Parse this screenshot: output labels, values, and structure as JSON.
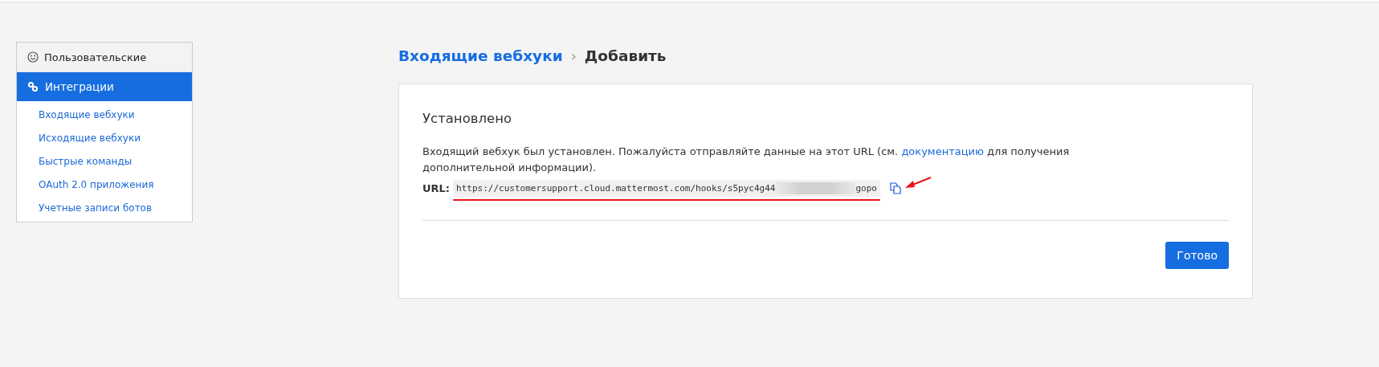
{
  "sidebar": {
    "section": {
      "label": "Пользовательские",
      "selected": false
    },
    "group": {
      "label": "Интеграции",
      "selected": true
    },
    "items": [
      {
        "label": "Входящие вебхуки",
        "selected": false
      },
      {
        "label": "Исходящие вебхуки",
        "selected": false
      },
      {
        "label": "Быстрые команды",
        "selected": false
      },
      {
        "label": "OAuth 2.0 приложения",
        "selected": false
      },
      {
        "label": "Учетные записи ботов",
        "selected": false
      }
    ]
  },
  "breadcrumb": {
    "parent": "Входящие вебхуки",
    "separator": "›",
    "current": "Добавить"
  },
  "card": {
    "title": "Установлено",
    "message_before": "Входящий вебхук был установлен. Пожалуйста отправляйте данные на этот URL (см.",
    "message_link": "документацию",
    "message_after": "для получения дополнительной информации).",
    "url_label": "URL:",
    "url_start": "https://customersupport.cloud.mattermost.com/hooks/s5pyc4g44",
    "url_end": "gopo",
    "button": "Готово"
  }
}
